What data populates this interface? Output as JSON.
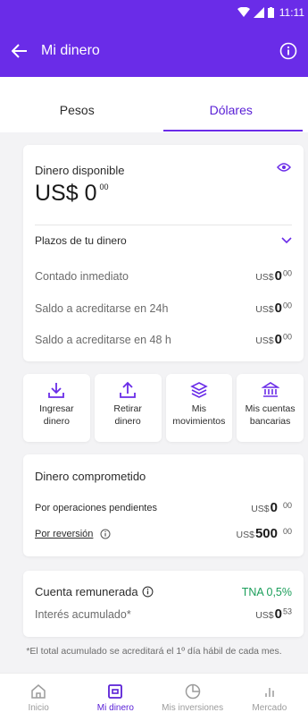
{
  "status_bar": {
    "time": "11:11"
  },
  "header": {
    "title": "Mi dinero"
  },
  "tabs": [
    {
      "label": "Pesos"
    },
    {
      "label": "Dólares"
    }
  ],
  "available": {
    "label": "Dinero disponible",
    "currency": "US$",
    "amount": "0",
    "cents": "00"
  },
  "plazos": {
    "label": "Plazos de tu dinero",
    "rows": [
      {
        "label": "Contado inmediato",
        "currency": "US$",
        "amount": "0",
        "cents": "00"
      },
      {
        "label": "Saldo a acreditarse en 24h",
        "currency": "US$",
        "amount": "0",
        "cents": "00"
      },
      {
        "label": "Saldo a acreditarse en 48 h",
        "currency": "US$",
        "amount": "0",
        "cents": "00"
      }
    ]
  },
  "actions": [
    {
      "line1": "Ingresar",
      "line2": "dinero"
    },
    {
      "line1": "Retirar",
      "line2": "dinero"
    },
    {
      "line1": "Mis",
      "line2": "movimientos"
    },
    {
      "line1": "Mis cuentas",
      "line2": "bancarias"
    }
  ],
  "comprometido": {
    "title": "Dinero comprometido",
    "rows": [
      {
        "label": "Por operaciones pendientes",
        "currency": "US$",
        "amount": "0",
        "cents": "00"
      },
      {
        "label": "Por reversión",
        "currency": "US$",
        "amount": "500",
        "cents": "00"
      }
    ]
  },
  "remunerada": {
    "label": "Cuenta remunerada",
    "rate": "TNA 0,5%",
    "interest_label": "Interés acumulado*",
    "currency": "US$",
    "amount": "0",
    "cents": "53"
  },
  "footnote": "*El total acumulado se acreditará el 1º día hábil de cada mes.",
  "bottom_nav": [
    {
      "label": "Inicio"
    },
    {
      "label": "Mi dinero"
    },
    {
      "label": "Mis inversiones"
    },
    {
      "label": "Mercado"
    }
  ],
  "colors": {
    "brand": "#6a2ce8",
    "accent_text": "#5a20d6",
    "rate_green": "#1a9e5a"
  }
}
